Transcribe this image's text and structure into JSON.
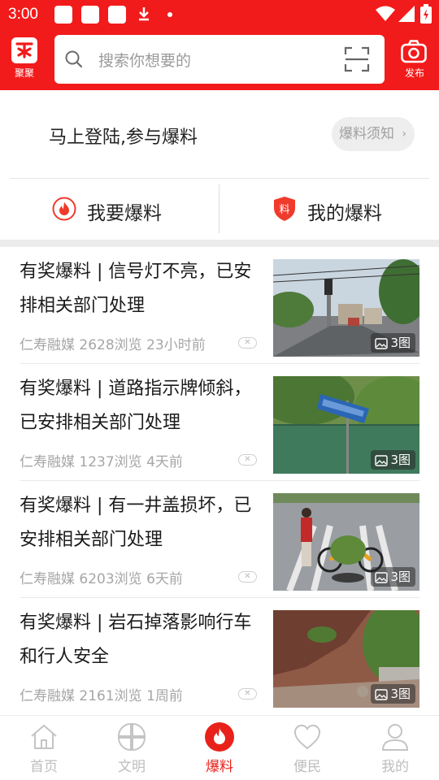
{
  "status_bar": {
    "time": "3:00"
  },
  "header": {
    "logo_label": "聚聚",
    "search_placeholder": "搜索你想要的",
    "publish_label": "发布",
    "brand_color": "#f21b1b"
  },
  "login": {
    "prompt": "马上登陆,参与爆料",
    "notice_button": "爆料须知"
  },
  "tabs": [
    {
      "label": "我要爆料",
      "icon": "flame-icon"
    },
    {
      "label": "我的爆料",
      "icon": "shield-icon",
      "icon_text": "料"
    }
  ],
  "articles": [
    {
      "title": "有奖爆料 | 信号灯不亮，已安排相关部门处理",
      "source": "仁寿融媒",
      "views": "2628浏览",
      "time": "23小时前",
      "image_count": "3图"
    },
    {
      "title": "有奖爆料 | 道路指示牌倾斜，已安排相关部门处理",
      "source": "仁寿融媒",
      "views": "1237浏览",
      "time": "4天前",
      "image_count": "3图"
    },
    {
      "title": "有奖爆料 | 有一井盖损坏，已安排相关部门处理",
      "source": "仁寿融媒",
      "views": "6203浏览",
      "time": "6天前",
      "image_count": "3图"
    },
    {
      "title": "有奖爆料 | 岩石掉落影响行车和行人安全",
      "source": "仁寿融媒",
      "views": "2161浏览",
      "time": "1周前",
      "image_count": "3图"
    }
  ],
  "bottom_nav": [
    {
      "label": "首页",
      "icon": "home-icon",
      "active": false
    },
    {
      "label": "文明",
      "icon": "grid-icon",
      "active": false
    },
    {
      "label": "爆料",
      "icon": "flame-icon",
      "active": true
    },
    {
      "label": "便民",
      "icon": "heart-icon",
      "active": false
    },
    {
      "label": "我的",
      "icon": "person-icon",
      "active": false
    }
  ],
  "active_color": "#e8221b"
}
